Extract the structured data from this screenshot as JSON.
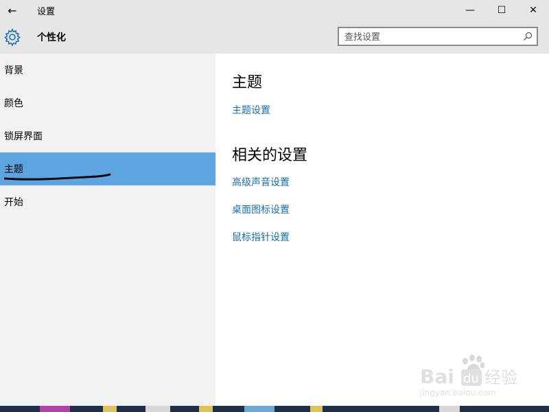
{
  "window": {
    "title": "设置",
    "back_glyph": "←",
    "minimize_glyph": "—",
    "maximize_glyph": "☐",
    "close_glyph": "✕"
  },
  "header": {
    "title": "个性化",
    "icon": "gear-icon"
  },
  "search": {
    "placeholder": "查找设置",
    "icon": "search-icon"
  },
  "sidebar": {
    "items": [
      {
        "label": "背景",
        "selected": false
      },
      {
        "label": "颜色",
        "selected": false
      },
      {
        "label": "锁屏界面",
        "selected": false
      },
      {
        "label": "主题",
        "selected": true
      },
      {
        "label": "开始",
        "selected": false
      }
    ],
    "selected_color": "#5ea4e0"
  },
  "main": {
    "section1": {
      "heading": "主题",
      "links": [
        "主题设置"
      ]
    },
    "section2": {
      "heading": "相关的设置",
      "links": [
        "高级声音设置",
        "桌面图标设置",
        "鼠标指针设置"
      ]
    },
    "link_color": "#1a6fb0"
  },
  "watermark": {
    "text": "Bai du 经验",
    "url_text": "jingyan.baidu.com"
  }
}
